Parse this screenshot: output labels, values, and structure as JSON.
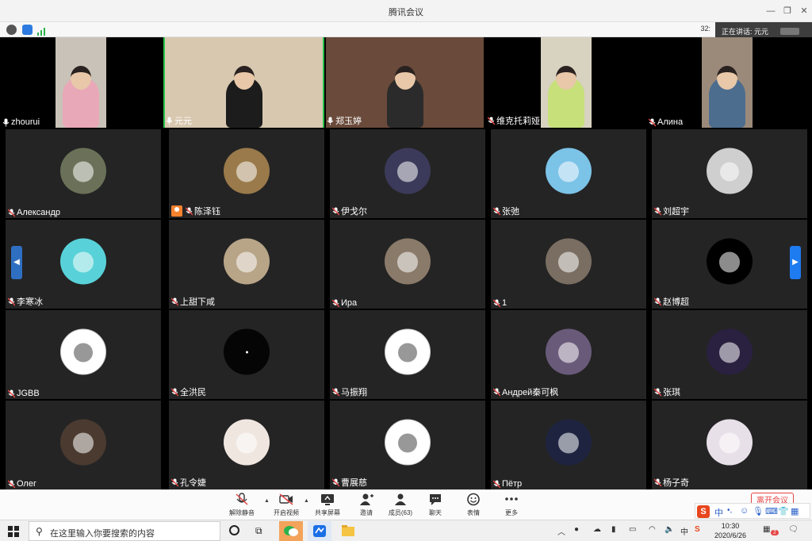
{
  "window": {
    "title": "腾讯会议"
  },
  "info_bar": {
    "timer": "32:",
    "speaking_label": "正在讲话: 元元"
  },
  "top_row": [
    {
      "name": "zhourui",
      "bg": "#c9c2b8",
      "person": "#e9a8b8"
    },
    {
      "name": "元元",
      "bg": "#d8c8b0",
      "person": "#1c1c1c",
      "active": true
    },
    {
      "name": "郑玉婷",
      "bg": "#6a4a3a",
      "person": "#2b2b2b"
    },
    {
      "name": "维克托莉娅",
      "bg": "#d8d2c0",
      "person": "#c7e07a"
    },
    {
      "name": "Алина",
      "bg": "#9b8a7a",
      "person": "#4d6d8f"
    }
  ],
  "participants": [
    {
      "name": "Александр",
      "avatar": "#6a7158",
      "icon": "camera-photo-icon"
    },
    {
      "name": "陈泽钰",
      "avatar": "#9a7a4a",
      "icon": "lion-icon",
      "host": true
    },
    {
      "name": "伊戈尔",
      "avatar": "#3b3a5a",
      "icon": "building-icon"
    },
    {
      "name": "张弛",
      "avatar": "#7cc3e8",
      "icon": "patrick-star-icon"
    },
    {
      "name": "刘超宇",
      "avatar": "#cfcfcf",
      "icon": "motorbike-icon"
    },
    {
      "name": "李寒冰",
      "avatar": "#58d2d8",
      "icon": "patrick-star-icon"
    },
    {
      "name": "上甜下咸",
      "avatar": "#b8a588",
      "icon": "person-photo-icon"
    },
    {
      "name": "Ира",
      "avatar": "#8a7a6a",
      "icon": "anime-girl-icon"
    },
    {
      "name": "1",
      "avatar": "#7a6e62",
      "icon": "cat-icon"
    },
    {
      "name": "赵博超",
      "avatar": "#000000",
      "icon": "jordan-logo-icon"
    },
    {
      "name": "JGBB",
      "avatar": "#ffffff",
      "icon": "baby-icon"
    },
    {
      "name": "全洪民",
      "avatar": "#050505",
      "icon": "dark-avatar-icon"
    },
    {
      "name": "马振翔",
      "avatar": "#ffffff",
      "icon": "panda-icon"
    },
    {
      "name": "Андрей秦可枫",
      "avatar": "#6a5a7a",
      "icon": "cartoon-couple-icon"
    },
    {
      "name": "张琪",
      "avatar": "#2a2040",
      "icon": "anime-girl-icon"
    },
    {
      "name": "Олег",
      "avatar": "#4a3a30",
      "icon": "ninja-icon"
    },
    {
      "name": "孔令婕",
      "avatar": "#f0e6e0",
      "icon": "girl-photo-icon"
    },
    {
      "name": "曹展慈",
      "avatar": "#ffffff",
      "icon": "cartoon-sticker-icon"
    },
    {
      "name": "Пётр",
      "avatar": "#1e2440",
      "icon": "night-sky-icon"
    },
    {
      "name": "杨子奇",
      "avatar": "#e8e0e8",
      "icon": "anime-girl-icon"
    }
  ],
  "toolbar": {
    "unmute": "解除静音",
    "start_video": "开启视频",
    "share_screen": "共享屏幕",
    "invite": "邀请",
    "members": "成员(63)",
    "chat": "聊天",
    "reactions": "表情",
    "more": "更多",
    "end_meeting": "离开会议"
  },
  "taskbar": {
    "search_placeholder": "在这里输入你要搜索的内容",
    "ime_label": "中",
    "time": "10:30",
    "date": "2020/6/26",
    "badge": "2"
  },
  "colors": {
    "active_speaker": "#29c34a",
    "pager": "#1e6fd6",
    "end_meeting": "#e64545"
  }
}
